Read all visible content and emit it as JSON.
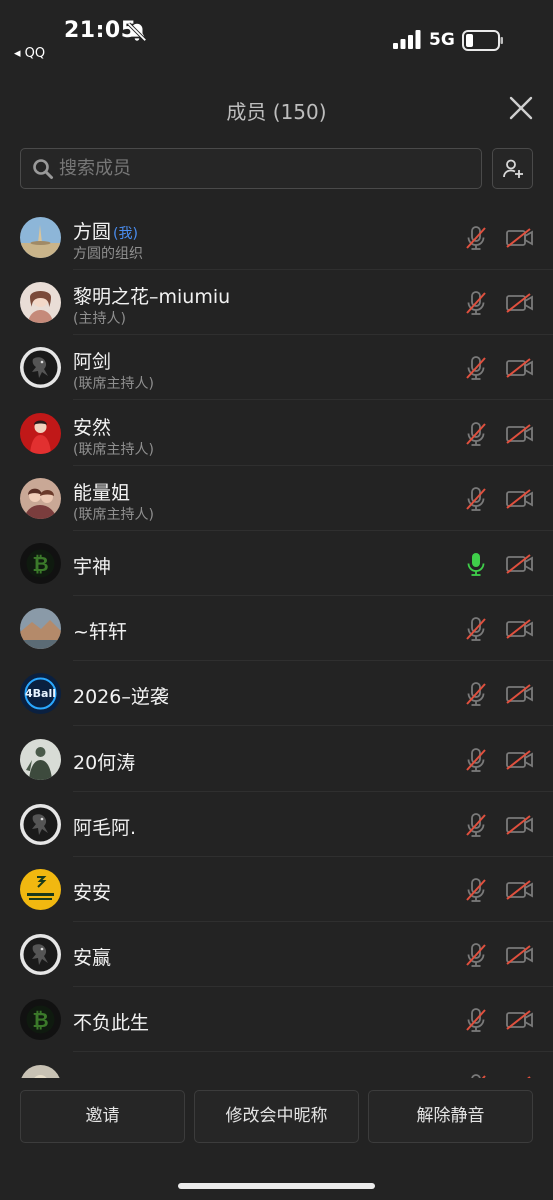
{
  "status_bar": {
    "time": "21:05",
    "back_app": "◂ QQ",
    "network": "5G",
    "icons": [
      "bell-off-icon",
      "signal-icon",
      "battery-low-icon"
    ]
  },
  "header": {
    "title": "成员 (150)",
    "close_icon": "close-icon"
  },
  "search": {
    "placeholder": "搜索成员",
    "value": "",
    "add_icon": "add-member-icon"
  },
  "members": [
    {
      "name": "方圆",
      "tag": "(我)",
      "subtitle": "方圆的组织",
      "avatar": "landscape",
      "mic": "muted",
      "camera": "off"
    },
    {
      "name": "黎明之花–miumiu",
      "tag": "",
      "subtitle": "(主持人)",
      "avatar": "portrait-light",
      "mic": "muted",
      "camera": "off"
    },
    {
      "name": "阿剑",
      "tag": "",
      "subtitle": "(联席主持人)",
      "avatar": "dragon-logo",
      "mic": "muted",
      "camera": "off"
    },
    {
      "name": "安然",
      "tag": "",
      "subtitle": "(联席主持人)",
      "avatar": "portrait-red",
      "mic": "muted",
      "camera": "off"
    },
    {
      "name": "能量姐",
      "tag": "",
      "subtitle": "(联席主持人)",
      "avatar": "portrait-warm",
      "mic": "muted",
      "camera": "off"
    },
    {
      "name": "宇神",
      "tag": "",
      "subtitle": "",
      "avatar": "bitcoin",
      "mic": "active",
      "camera": "off"
    },
    {
      "name": "~轩轩",
      "tag": "",
      "subtitle": "",
      "avatar": "scenic",
      "mic": "muted",
      "camera": "off"
    },
    {
      "name": "2026–逆袭",
      "tag": "",
      "subtitle": "",
      "avatar": "4ball",
      "mic": "muted",
      "camera": "off"
    },
    {
      "name": "20何涛",
      "tag": "",
      "subtitle": "",
      "avatar": "statue",
      "mic": "muted",
      "camera": "off"
    },
    {
      "name": "阿毛阿.",
      "tag": "",
      "subtitle": "",
      "avatar": "dragon-logo",
      "mic": "muted",
      "camera": "off"
    },
    {
      "name": "安安",
      "tag": "",
      "subtitle": "",
      "avatar": "yellow-script",
      "mic": "muted",
      "camera": "off"
    },
    {
      "name": "安赢",
      "tag": "",
      "subtitle": "",
      "avatar": "dragon-logo",
      "mic": "muted",
      "camera": "off"
    },
    {
      "name": "不负此生",
      "tag": "",
      "subtitle": "",
      "avatar": "bitcoin",
      "mic": "muted",
      "camera": "off"
    },
    {
      "name": "",
      "tag": "",
      "subtitle": "",
      "avatar": "partial",
      "mic": "muted",
      "camera": "off"
    }
  ],
  "bottom_bar": {
    "invite": "邀请",
    "rename": "修改会中昵称",
    "unmute": "解除静音"
  },
  "colors": {
    "background": "#232323",
    "accent_blue": "#4a8df0",
    "mute_red": "#e0503e",
    "active_green": "#3fcf4a"
  }
}
